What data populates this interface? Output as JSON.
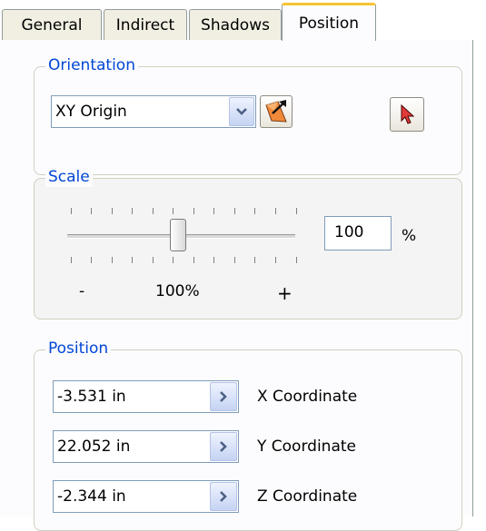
{
  "tabs": [
    {
      "label": "General"
    },
    {
      "label": "Indirect"
    },
    {
      "label": "Shadows"
    },
    {
      "label": "Position",
      "active": true
    }
  ],
  "orientation": {
    "legend": "Orientation",
    "selected": "XY Origin"
  },
  "scale": {
    "legend": "Scale",
    "minus_label": "-",
    "current_label": "100%",
    "plus_label": "+",
    "value": "100",
    "unit": "%"
  },
  "position": {
    "legend": "Position",
    "rows": [
      {
        "value": "-3.531 in",
        "label": "X Coordinate"
      },
      {
        "value": "22.052 in",
        "label": "Y Coordinate"
      },
      {
        "value": "-2.344 in",
        "label": "Z Coordinate"
      }
    ]
  },
  "colors": {
    "legend_text": "#0046d5",
    "active_tab_accent": "#f7c434",
    "field_border": "#7f9db9"
  }
}
